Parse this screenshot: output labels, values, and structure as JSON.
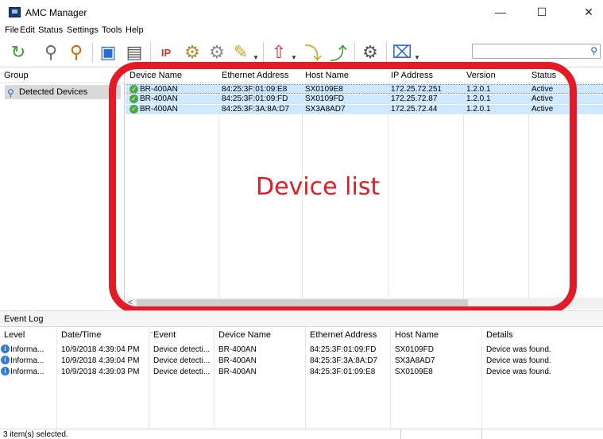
{
  "window": {
    "title": "AMC Manager",
    "minimize_glyph": "—",
    "maximize_glyph": "☐",
    "close_glyph": "✕"
  },
  "menu": [
    {
      "label": "File"
    },
    {
      "label": "Edit"
    },
    {
      "label": "Status"
    },
    {
      "label": "Settings"
    },
    {
      "label": "Tools"
    },
    {
      "label": "Help"
    }
  ],
  "toolbar": {
    "buttons": [
      {
        "icon": "refresh-icon",
        "glyph": "↻",
        "color": "#3c9a2e"
      },
      {
        "icon": "zoom-out-icon",
        "glyph": "⚲",
        "color": "#6a6a6a"
      },
      {
        "icon": "zoom-in-icon",
        "glyph": "⚲",
        "color": "#c26a00"
      },
      {
        "icon": "web-config-icon",
        "glyph": "▣",
        "color": "#2a6ad2"
      },
      {
        "icon": "device-settings-icon",
        "glyph": "▤",
        "color": "#555555"
      },
      {
        "icon": "ip-settings-icon",
        "glyph": "IP",
        "color": "#d4302a"
      },
      {
        "icon": "firmware-icon",
        "glyph": "⚙",
        "color": "#b08a2a"
      },
      {
        "icon": "group-icon",
        "glyph": "⚙",
        "color": "#8a8a8a"
      },
      {
        "icon": "edit-icon",
        "glyph": "✎",
        "color": "#c9a516"
      },
      {
        "icon": "upload-icon",
        "glyph": "⇧",
        "color": "#d4302a"
      },
      {
        "icon": "import-icon",
        "glyph": "⤵",
        "color": "#c9a516"
      },
      {
        "icon": "export-icon",
        "glyph": "⤴",
        "color": "#3c9a2e"
      },
      {
        "icon": "gear-icon",
        "glyph": "⚙",
        "color": "#555555"
      },
      {
        "icon": "tools-icon",
        "glyph": "⌧",
        "color": "#2a6ad2"
      }
    ],
    "search_placeholder": ""
  },
  "group_pane": {
    "header": "Group",
    "items": [
      {
        "label": "Detected Devices"
      }
    ]
  },
  "device_list": {
    "columns": [
      "Device Name",
      "Ethernet Address",
      "Host Name",
      "IP Address",
      "Version",
      "Status"
    ],
    "rows": [
      {
        "device": "BR-400AN",
        "mac": "84:25:3F:01:09:E8",
        "host": "SX0109E8",
        "ip": "172.25.72.251",
        "version": "1.2.0.1",
        "status": "Active"
      },
      {
        "device": "BR-400AN",
        "mac": "84:25:3F:01:09:FD",
        "host": "SX0109FD",
        "ip": "172.25.72.87",
        "version": "1.2.0.1",
        "status": "Active"
      },
      {
        "device": "BR-400AN",
        "mac": "84:25:3F:3A:8A:D7",
        "host": "SX3A8AD7",
        "ip": "172.25.72.44",
        "version": "1.2.0.1",
        "status": "Active"
      }
    ]
  },
  "callout": {
    "label": "Device list",
    "color": "#e21b24"
  },
  "event_log": {
    "title": "Event Log",
    "columns": [
      "Level",
      "Date/Time",
      "Event",
      "Device Name",
      "Ethernet Address",
      "Host Name",
      "Details"
    ],
    "rows": [
      {
        "level": "Informa...",
        "datetime": "10/9/2018 4:39:04 PM",
        "event": "Device detecti...",
        "device": "BR-400AN",
        "mac": "84:25:3F:01:09:FD",
        "host": "SX0109FD",
        "details": "Device was found."
      },
      {
        "level": "Informa...",
        "datetime": "10/9/2018 4:39:04 PM",
        "event": "Device detecti...",
        "device": "BR-400AN",
        "mac": "84:25:3F:3A:8A:D7",
        "host": "SX3A8AD7",
        "details": "Device was found."
      },
      {
        "level": "Informa...",
        "datetime": "10/9/2018 4:39:03 PM",
        "event": "Device detecti...",
        "device": "BR-400AN",
        "mac": "84:25:3F:01:09:E8",
        "host": "SX0109E8",
        "details": "Device was found."
      }
    ]
  },
  "status": {
    "text": "3 item(s) selected."
  }
}
